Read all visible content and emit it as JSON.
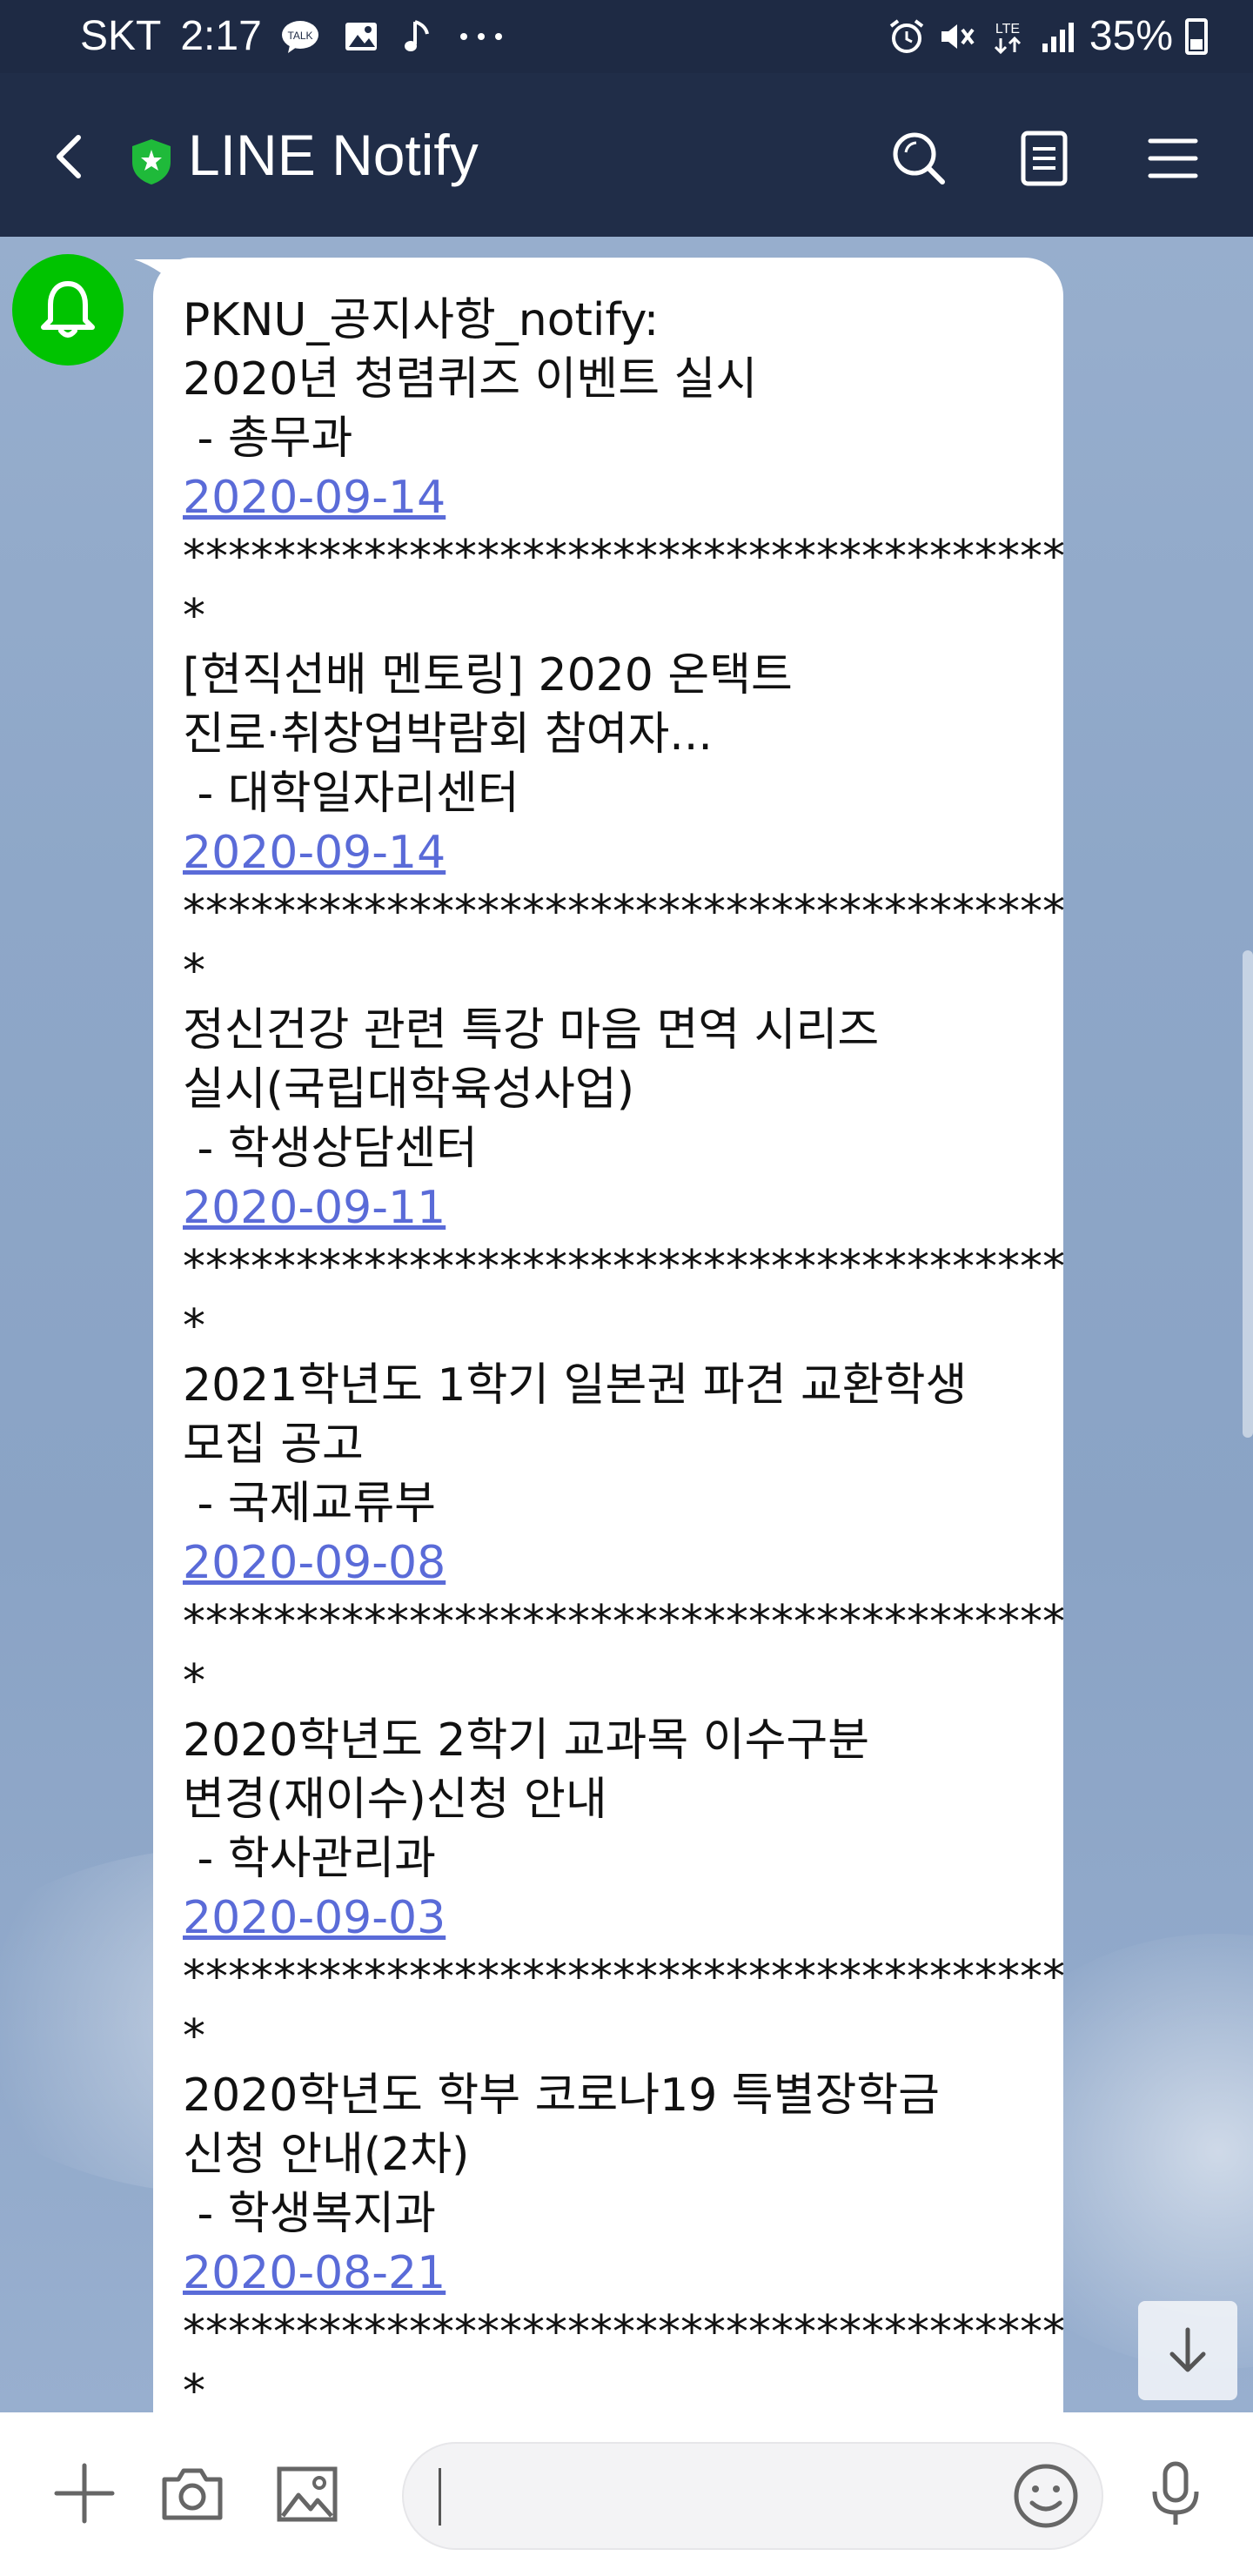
{
  "status_bar": {
    "carrier": "SKT",
    "time": "2:17",
    "notification_icons": [
      "talk-icon",
      "gallery-icon",
      "music-icon",
      "more-dots-icon"
    ],
    "system_icons": [
      "alarm-icon",
      "mute-icon",
      "lte-icon",
      "signal-icon"
    ],
    "network": "LTE",
    "battery": "35%"
  },
  "header": {
    "title": "LINE Notify",
    "buttons": [
      "search",
      "notes",
      "menu"
    ]
  },
  "chat": {
    "sender_avatar": "bell-icon",
    "message": {
      "heading": "PKNU_공지사항_notify:",
      "separator": "***************************************\n*",
      "items": [
        {
          "title_lines": [
            "2020년 청렴퀴즈 이벤트 실시"
          ],
          "dept": " - 총무과",
          "date": "2020-09-14"
        },
        {
          "title_lines": [
            "[현직선배 멘토링] 2020 온택트",
            "진로·취창업박람회 참여자..."
          ],
          "dept": " - 대학일자리센터",
          "date": "2020-09-14"
        },
        {
          "title_lines": [
            "정신건강 관련 특강 마음 면역 시리즈",
            "실시(국립대학육성사업)"
          ],
          "dept": " - 학생상담센터",
          "date": "2020-09-11"
        },
        {
          "title_lines": [
            "2021학년도 1학기 일본권 파견 교환학생",
            "모집 공고"
          ],
          "dept": " - 국제교류부",
          "date": "2020-09-08"
        },
        {
          "title_lines": [
            "2020학년도 2학기 교과목 이수구분",
            "변경(재이수)신청 안내"
          ],
          "dept": " - 학사관리과",
          "date": "2020-09-03"
        },
        {
          "title_lines": [
            "2020학년도 학부 코로나19 특별장학금",
            "신청 안내(2차)"
          ],
          "dept": " - 학생복지과",
          "date": "2020-08-21"
        }
      ]
    }
  },
  "bottom_bar": {
    "input_value": "",
    "icons": [
      "plus-icon",
      "camera-icon",
      "image-icon",
      "emoji-icon",
      "microphone-icon"
    ]
  },
  "colors": {
    "header_bg": "#202d48",
    "status_bg": "#1e2a44",
    "line_green": "#00c300",
    "link": "#5a6bd8"
  }
}
